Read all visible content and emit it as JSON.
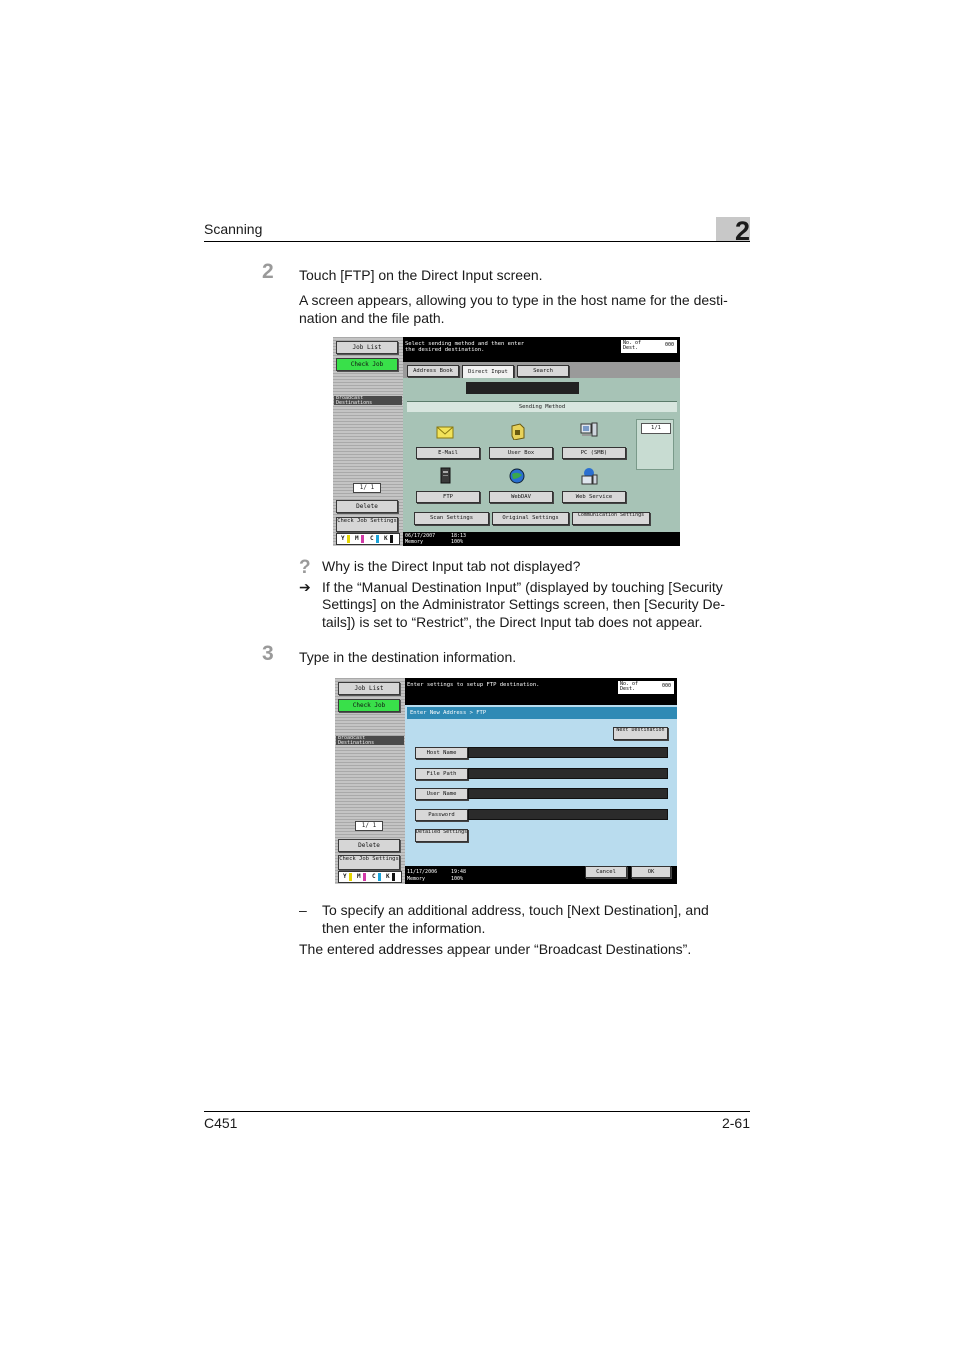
{
  "header": {
    "section": "Scanning",
    "chapter": "2"
  },
  "footer": {
    "model": "C451",
    "page": "2-61"
  },
  "step2": {
    "number": "2",
    "instruction": "Touch [FTP] on the Direct Input screen.",
    "para1": "A screen appears, allowing you to type in the host name for the desti-",
    "para2": "nation and the file path."
  },
  "screen1": {
    "job_list": "Job List",
    "check_job": "Check Job",
    "broadcast": "Broadcast Destinations",
    "pager": "1/ 1",
    "delete": "Delete",
    "check_job_settings": "Check Job Settings",
    "message_line1": "Select sending method and then enter",
    "message_line2": "the desired destination.",
    "dest_label": "No. of Dest.",
    "dest_count": "000",
    "tab_address_book": "Address Book",
    "tab_direct_input": "Direct Input",
    "tab_search": "Search",
    "sending_method": "Sending Method",
    "page_indicator": "1/1",
    "methods": [
      "E-Mail",
      "User Box",
      "PC (SMB)",
      "FTP",
      "WebDAV",
      "Web Service"
    ],
    "scan_settings": "Scan Settings",
    "original_settings": "Original Settings",
    "communication_settings": "Communication Settings",
    "date": "06/17/2007",
    "time": "18:13",
    "memory_label": "Memory",
    "memory": "100%"
  },
  "note": {
    "question": "Why is the Direct Input tab not displayed?",
    "arrow": "➔",
    "answer_l1": "If the “Manual Destination Input” (displayed by touching [Security",
    "answer_l2": "Settings] on the Administrator Settings screen, then [Security De-",
    "answer_l3": "tails]) is set to “Restrict”, the Direct Input tab does not appear."
  },
  "step3": {
    "number": "3",
    "instruction": "Type in the destination information."
  },
  "screen2": {
    "job_list": "Job List",
    "check_job": "Check Job",
    "broadcast": "Broadcast Destinations",
    "pager": "1/ 1",
    "delete": "Delete",
    "check_job_settings": "Check Job Settings",
    "message": "Enter settings to setup FTP destination.",
    "dest_label": "No. of Dest.",
    "dest_count": "000",
    "breadcrumb": "Enter New Address > FTP",
    "next_destination": "Next Destination",
    "fields": [
      "Host Name",
      "File Path",
      "User Name",
      "Password"
    ],
    "detailed_settings": "Detailed Settings",
    "date": "11/17/2006",
    "time": "19:48",
    "memory_label": "Memory",
    "memory": "100%",
    "cancel": "Cancel",
    "ok": "OK"
  },
  "after": {
    "dash": "–",
    "bullet_l1": "To specify an additional address, touch [Next Destination], and",
    "bullet_l2": "then enter the information.",
    "result": "The entered addresses appear under “Broadcast Destinations”."
  },
  "colors": {
    "panel_green": "#a7c3b6",
    "panel_blue": "#b9dcee",
    "banner_blue": "#2f8ab5",
    "check_green": "#39e04a"
  }
}
